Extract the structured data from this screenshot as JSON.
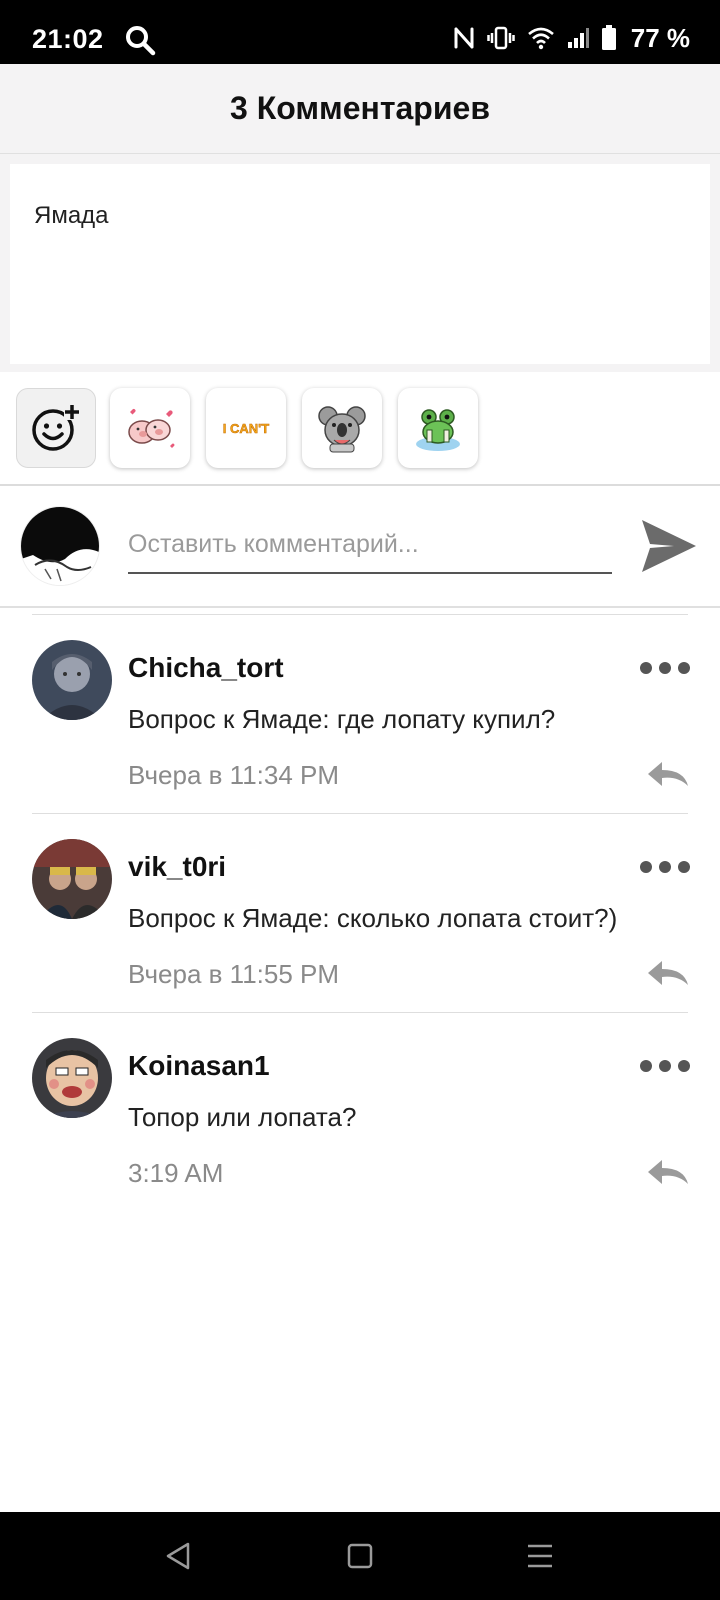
{
  "status_bar": {
    "time": "21:02",
    "battery": "77 %"
  },
  "header": {
    "title": "3 Комментариев"
  },
  "post": {
    "text": "Ямада"
  },
  "stickers": [
    {
      "name": "emoji-add-icon"
    },
    {
      "name": "pigs-sticker"
    },
    {
      "name": "i-cant-sticker",
      "text": "I CAN'T"
    },
    {
      "name": "koala-sticker"
    },
    {
      "name": "frog-sticker"
    }
  ],
  "composer": {
    "placeholder": "Оставить комментарий..."
  },
  "comments": [
    {
      "author": "Chicha_tort",
      "text": "Вопрос к Ямаде: где лопату купил?",
      "time": "Вчера в 11:34 PM"
    },
    {
      "author": "vik_t0ri",
      "text": "Вопрос к Ямаде: сколько лопата стоит?)",
      "time": "Вчера в 11:55 PM"
    },
    {
      "author": "Koinasan1",
      "text": "Топор или лопата?",
      "time": "3:19 AM"
    }
  ],
  "colors": {
    "header_bg": "#f4f3f4",
    "divider": "#dedede",
    "muted_text": "#8a8a8a",
    "send_icon": "#6b6b6b"
  }
}
